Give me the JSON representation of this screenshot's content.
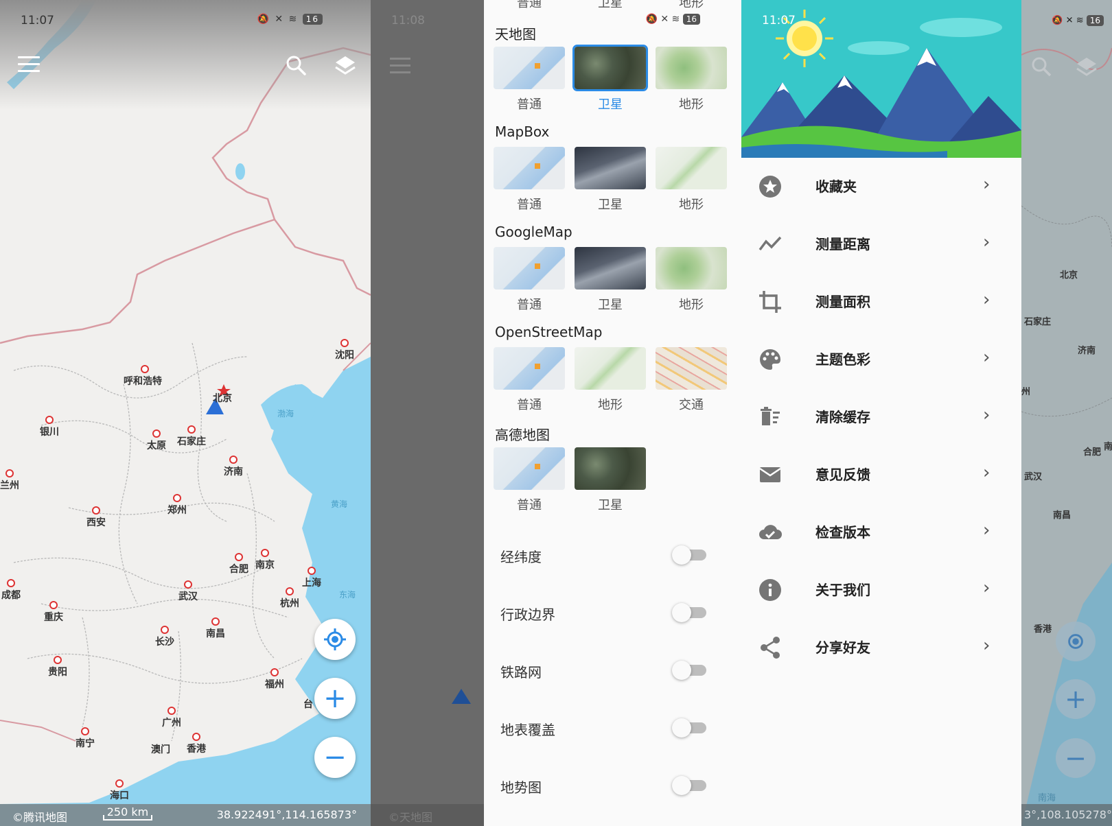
{
  "map_panel": {
    "status": {
      "time": "11:07",
      "battery": "16"
    },
    "cities": [
      {
        "name": "呼和浩特"
      },
      {
        "name": "北京"
      },
      {
        "name": "沈阳"
      },
      {
        "name": "银川"
      },
      {
        "name": "太原"
      },
      {
        "name": "石家庄"
      },
      {
        "name": "济南"
      },
      {
        "name": "兰州"
      },
      {
        "name": "西安"
      },
      {
        "name": "郑州"
      },
      {
        "name": "合肥"
      },
      {
        "name": "南京"
      },
      {
        "name": "上海"
      },
      {
        "name": "成都"
      },
      {
        "name": "武汉"
      },
      {
        "name": "杭州"
      },
      {
        "name": "重庆"
      },
      {
        "name": "长沙"
      },
      {
        "name": "南昌"
      },
      {
        "name": "贵阳"
      },
      {
        "name": "福州"
      },
      {
        "name": "台"
      },
      {
        "name": "广州"
      },
      {
        "name": "南宁"
      },
      {
        "name": "澳门"
      },
      {
        "name": "香港"
      },
      {
        "name": "海口"
      }
    ],
    "seas": {
      "bohai": "渤海",
      "yellow": "黄海",
      "east": "东海"
    },
    "attribution": "©腾讯地图",
    "scale": "250 km",
    "coords": "38.922491°,114.165873°",
    "fab": {
      "plus": "+",
      "minus": "−"
    }
  },
  "layers_panel": {
    "dim_time": "11:08",
    "dim_attribution": "©天地图",
    "top_labels": [
      "普通",
      "卫星",
      "地形"
    ],
    "groups": [
      {
        "title": "天地图",
        "items": [
          {
            "label": "普通",
            "selected": false
          },
          {
            "label": "卫星",
            "selected": true
          },
          {
            "label": "地形",
            "selected": false
          }
        ]
      },
      {
        "title": "MapBox",
        "items": [
          {
            "label": "普通",
            "selected": false
          },
          {
            "label": "卫星",
            "selected": false
          },
          {
            "label": "地形",
            "selected": false
          }
        ]
      },
      {
        "title": "GoogleMap",
        "items": [
          {
            "label": "普通",
            "selected": false
          },
          {
            "label": "卫星",
            "selected": false
          },
          {
            "label": "地形",
            "selected": false
          }
        ]
      },
      {
        "title": "OpenStreetMap",
        "items": [
          {
            "label": "普通",
            "selected": false
          },
          {
            "label": "地形",
            "selected": false
          },
          {
            "label": "交通",
            "selected": false
          }
        ]
      },
      {
        "title": "高德地图",
        "items": [
          {
            "label": "普通",
            "selected": false
          },
          {
            "label": "卫星",
            "selected": false
          }
        ]
      }
    ],
    "toggles": [
      {
        "label": "经纬度",
        "on": false
      },
      {
        "label": "行政边界",
        "on": false
      },
      {
        "label": "铁路网",
        "on": false
      },
      {
        "label": "地表覆盖",
        "on": false
      },
      {
        "label": "地势图",
        "on": false
      }
    ]
  },
  "drawer_panel": {
    "status": {
      "time": "11:07",
      "battery": "16"
    },
    "menu": [
      {
        "label": "收藏夹",
        "icon": "star-icon"
      },
      {
        "label": "测量距离",
        "icon": "polyline-icon"
      },
      {
        "label": "测量面积",
        "icon": "crop-icon"
      },
      {
        "label": "主题色彩",
        "icon": "palette-icon"
      },
      {
        "label": "清除缓存",
        "icon": "trash-icon"
      },
      {
        "label": "意见反馈",
        "icon": "mail-icon"
      },
      {
        "label": "检查版本",
        "icon": "cloud-check-icon"
      },
      {
        "label": "关于我们",
        "icon": "info-icon"
      },
      {
        "label": "分享好友",
        "icon": "share-icon"
      }
    ],
    "bg_cities": [
      {
        "name": "北京"
      },
      {
        "name": "石家庄"
      },
      {
        "name": "济南"
      },
      {
        "name": "州"
      },
      {
        "name": "合肥"
      },
      {
        "name": "南"
      },
      {
        "name": "武汉"
      },
      {
        "name": "南昌"
      },
      {
        "name": "香港"
      }
    ],
    "bg_sea": "南海",
    "bg_coords": "3°,108.105278°",
    "chevron": "›"
  }
}
